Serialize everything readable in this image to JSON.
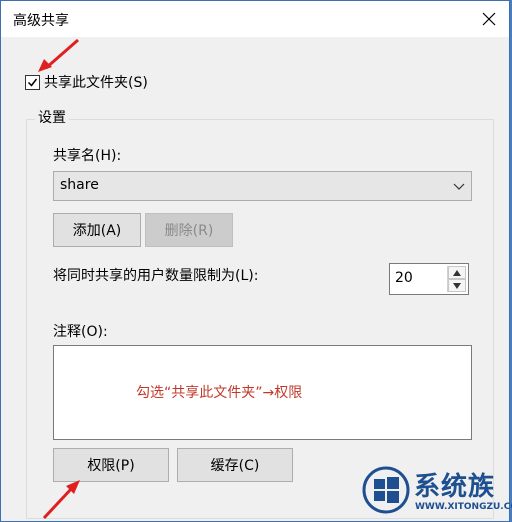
{
  "window": {
    "title": "高级共享"
  },
  "share_checkbox": {
    "label": "共享此文件夹(S)",
    "checked": true
  },
  "settings": {
    "legend": "设置",
    "share_name_label": "共享名(H):",
    "share_name_value": "share",
    "add_button": "添加(A)",
    "remove_button": "删除(R)",
    "user_limit_label": "将同时共享的用户数量限制为(L):",
    "user_limit_value": "20",
    "comment_label": "注释(O):",
    "comment_annotation": "勾选“共享此文件夹”→权限"
  },
  "buttons": {
    "permissions": "权限(P)",
    "caching": "缓存(C)"
  },
  "watermark": {
    "brand": "系统族",
    "url": "WWW.XITONGZU.COM"
  },
  "colors": {
    "annotation": "#c0392b",
    "arrow": "#e02020",
    "brand": "#1d4f91"
  }
}
